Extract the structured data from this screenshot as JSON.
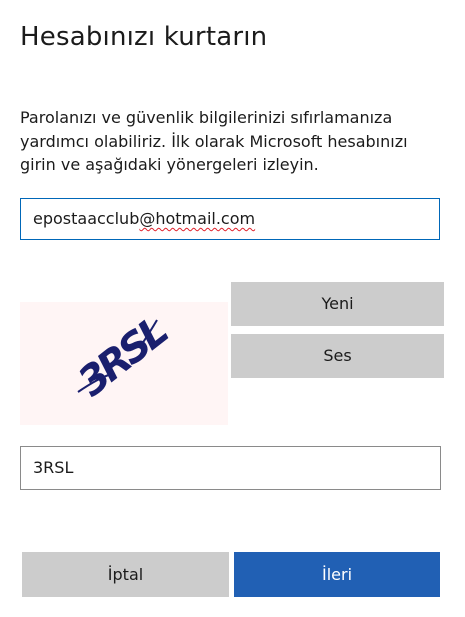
{
  "page": {
    "title": "Hesabınızı kurtarın",
    "description": "Parolanızı ve güvenlik bilgilerinizi sıfırlamanıza yardımcı olabiliriz. İlk olarak Microsoft hesabınızı girin ve aşağıdaki yönergeleri izleyin."
  },
  "email": {
    "value_prefix": "epostaacclub",
    "value_suffix": "@hotmail.com"
  },
  "captcha": {
    "image_text": "3RSL",
    "new_label": "Yeni",
    "audio_label": "Ses",
    "input_value": "3RSL"
  },
  "actions": {
    "cancel_label": "İptal",
    "next_label": "İleri"
  },
  "colors": {
    "primary": "#2160b4",
    "secondary": "#cccccc",
    "focus_border": "#0067b8",
    "captcha_ink": "#1a1f6e",
    "captcha_bg": "#fff5f5"
  }
}
